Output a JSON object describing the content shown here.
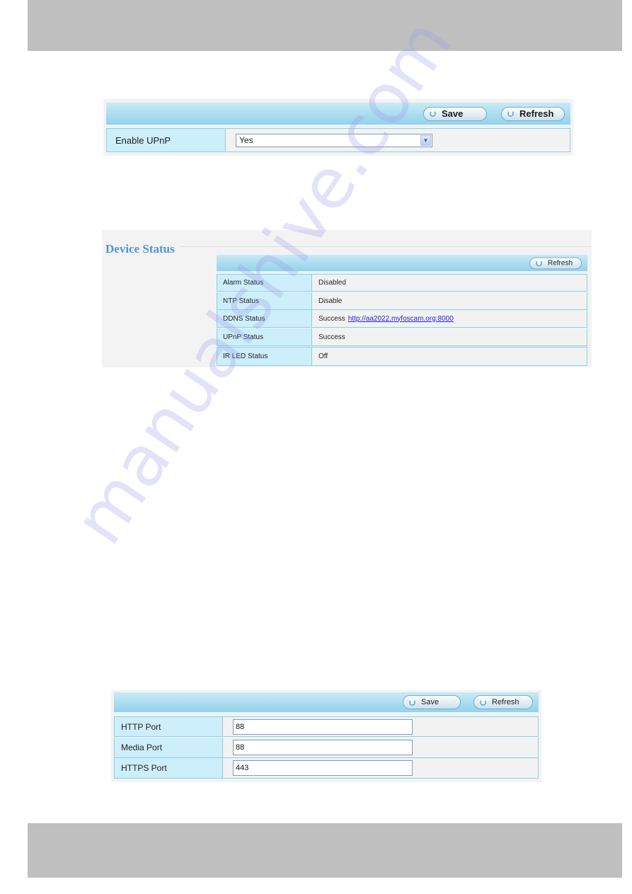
{
  "upnp_panel": {
    "toolbar": {
      "save_label": "Save",
      "refresh_label": "Refresh"
    },
    "field_label": "Enable UPnP",
    "select_value": "Yes"
  },
  "device_status": {
    "title": "Device Status",
    "refresh_label": "Refresh",
    "rows": [
      {
        "label": "Alarm Status",
        "value": "Disabled"
      },
      {
        "label": "NTP Status",
        "value": "Disable"
      },
      {
        "label": "DDNS Status",
        "value": "Success",
        "link": "http://aa2022.myfoscam.org:8000"
      },
      {
        "label": "UPnP Status",
        "value": "Success"
      },
      {
        "label": "IR LED Status",
        "value": "Off"
      }
    ]
  },
  "port_panel": {
    "toolbar": {
      "save_label": "Save",
      "refresh_label": "Refresh"
    },
    "rows": [
      {
        "label": "HTTP Port",
        "value": "88"
      },
      {
        "label": "Media Port",
        "value": "88"
      },
      {
        "label": "HTTPS Port",
        "value": "443"
      }
    ]
  },
  "watermark": "manualshive.com",
  "colors": {
    "band_gray": "#bfbfbf",
    "label_cell": "#cdeefb",
    "title_blue": "#4f95d6",
    "link_blue": "#2323d6"
  }
}
